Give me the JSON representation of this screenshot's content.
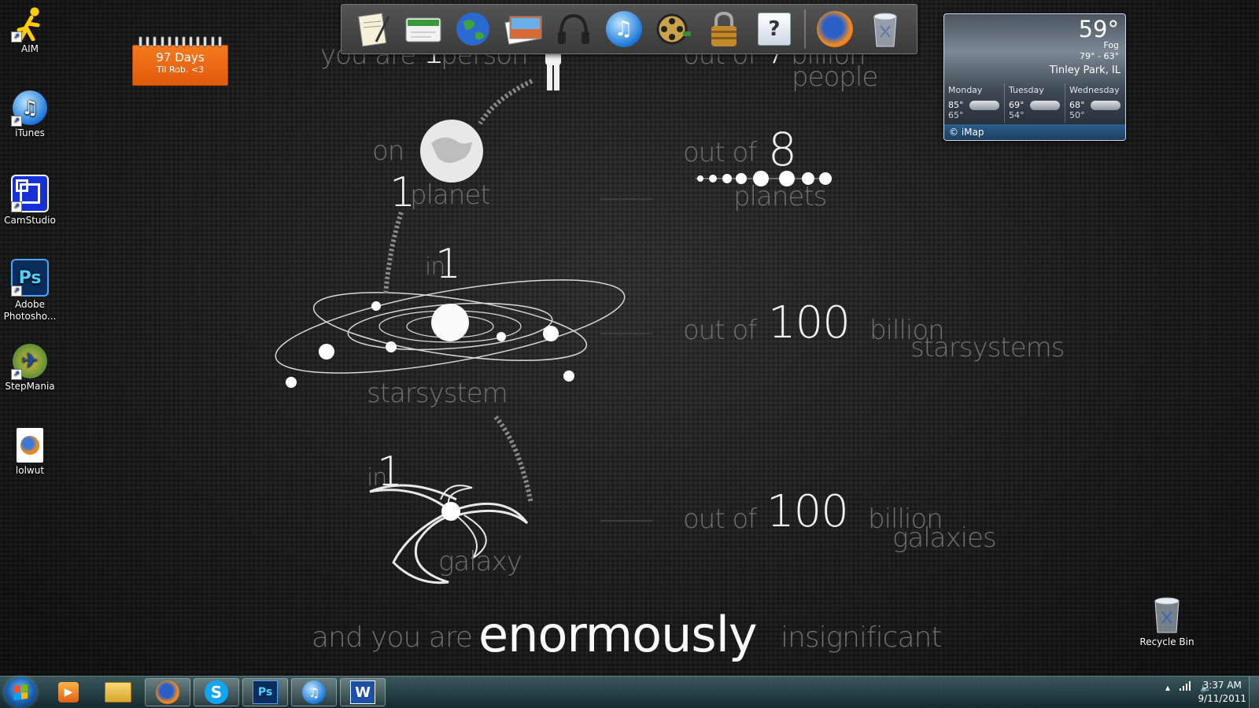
{
  "desktop_icons": [
    {
      "label": "AIM",
      "icon": "aim-runner-icon"
    },
    {
      "label": "iTunes",
      "icon": "itunes-icon"
    },
    {
      "label": "CamStudio",
      "icon": "camstudio-icon"
    },
    {
      "label": "Adobe Photosho...",
      "icon": "photoshop-icon"
    },
    {
      "label": "StepMania",
      "icon": "stepmania-icon"
    },
    {
      "label": "lolwut",
      "icon": "firefox-document-icon"
    }
  ],
  "recycle_bin": {
    "label": "Recycle Bin"
  },
  "countdown_gadget": {
    "days": "97 Days",
    "subtitle": "Til Rob. <3"
  },
  "dock": {
    "items": [
      "notepad-icon",
      "mail-icon",
      "globe-icon",
      "photos-icon",
      "headphones-icon",
      "itunes-icon",
      "film-reel-icon",
      "padlock-icon",
      "help-icon",
      "firefox-icon",
      "trash-icon"
    ]
  },
  "weather": {
    "temp": "59°",
    "condition": "Fog",
    "range": "79° - 63°",
    "location": "Tinley Park, IL",
    "forecast": [
      {
        "day": "Monday",
        "high": "85°",
        "low": "65°"
      },
      {
        "day": "Tuesday",
        "high": "69°",
        "low": "54°"
      },
      {
        "day": "Wednesday",
        "high": "68°",
        "low": "50°"
      }
    ],
    "credit": "© iMap"
  },
  "wallpaper": {
    "you_are": "you are ",
    "one": "1",
    "person": " person",
    "out_of": "out of ",
    "seven": "7",
    "billion": "billion",
    "people": "people",
    "on": "on",
    "planet": "planet",
    "eight": "8",
    "planets": "planets",
    "in": "in",
    "starsystem": "starsystem",
    "hundred": "100",
    "starsystems": "starsystems",
    "galaxy": "galaxy",
    "galaxies": "galaxies",
    "and_you_are": "and you are",
    "enormously": "enormously",
    "insignificant": "insignificant"
  },
  "taskbar": {
    "pinned": [
      "start-orb",
      "media-player-icon",
      "file-explorer-icon",
      "firefox-icon",
      "skype-icon",
      "photoshop-icon",
      "itunes-icon",
      "word-icon"
    ],
    "clock_time": "3:37 AM",
    "clock_date": "9/11/2011"
  },
  "colors": {
    "countdown_orange": "#ef6a14",
    "weather_bar": "#2c5f8f",
    "ps_blue": "#0a2d5c",
    "word_blue": "#1d4fa8"
  }
}
